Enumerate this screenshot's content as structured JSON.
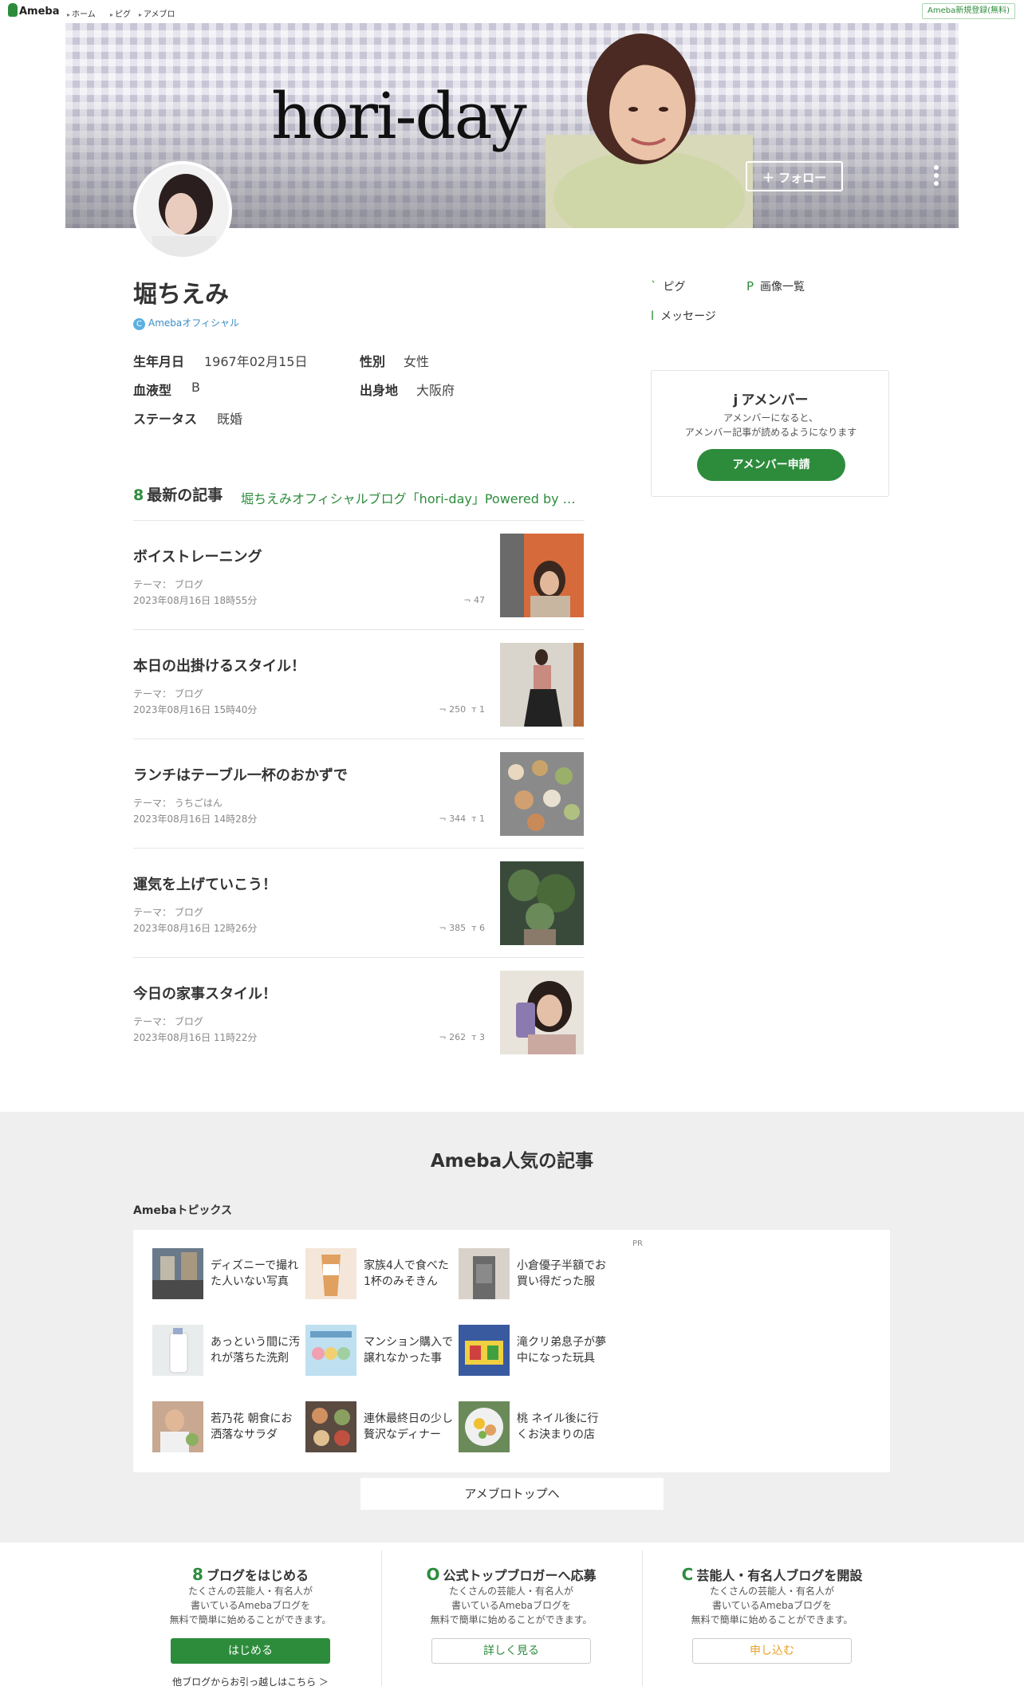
{
  "nav": {
    "logo": "Ameba",
    "crumbs": [
      "ホーム",
      "ピグ",
      "アメブロ"
    ],
    "signup": "Ameba新規登録(無料)"
  },
  "header": {
    "banner_title": "hori-day",
    "follow_label": "＋ フォロー"
  },
  "profile": {
    "name": "堀ちえみ",
    "official_badge": "C",
    "official_label": "Amebaオフィシャル",
    "fields": [
      {
        "label": "生年月日",
        "value": "1967年02月15日"
      },
      {
        "label": "性別",
        "value": "女性"
      },
      {
        "label": "血液型",
        "value": "B"
      },
      {
        "label": "出身地",
        "value": "大阪府"
      },
      {
        "label": "ステータス",
        "value": "既婚"
      }
    ]
  },
  "side_links": [
    {
      "icon": "`",
      "icon_name": "pigg-icon",
      "label": "ピグ"
    },
    {
      "icon": "P",
      "icon_name": "image-list-icon",
      "label": "画像一覧"
    },
    {
      "icon": "l",
      "icon_name": "message-icon",
      "label": "メッセージ"
    }
  ],
  "amember": {
    "icon": "j",
    "title": "アメンバー",
    "desc_line1": "アメンバーになると、",
    "desc_line2": "アメンバー記事が読めるようになります",
    "button": "アメンバー申請"
  },
  "latest": {
    "icon": "8",
    "heading": "最新の記事",
    "blog_name": "堀ちえみオフィシャルブログ「hori-day」Powered by Ameba",
    "articles": [
      {
        "title": "ボイストレーニング",
        "theme": "テーマ： ブログ",
        "date": "2023年08月16日 18時55分",
        "likes": "47",
        "comments": ""
      },
      {
        "title": "本日の出掛けるスタイル！",
        "theme": "テーマ： ブログ",
        "date": "2023年08月16日 15時40分",
        "likes": "250",
        "comments": "1"
      },
      {
        "title": "ランチはテーブル一杯のおかずで",
        "theme": "テーマ： うちごはん",
        "date": "2023年08月16日 14時28分",
        "likes": "344",
        "comments": "1"
      },
      {
        "title": "運気を上げていこう！",
        "theme": "テーマ： ブログ",
        "date": "2023年08月16日 12時26分",
        "likes": "385",
        "comments": "6"
      },
      {
        "title": "今日の家事スタイル！",
        "theme": "テーマ： ブログ",
        "date": "2023年08月16日 11時22分",
        "likes": "262",
        "comments": "3"
      }
    ]
  },
  "popular": {
    "title": "Ameba人気の記事",
    "topics_label": "Amebaトピックス",
    "pr": "PR",
    "topics": [
      {
        "line1": "ディズニーで撮れ",
        "line2": "た人いない写真"
      },
      {
        "line1": "家族4人で食べた",
        "line2": "1杯のみそきん"
      },
      {
        "line1": "小倉優子半額でお",
        "line2": "買い得だった服"
      },
      {
        "line1": "あっという間に汚",
        "line2": "れが落ちた洗剤"
      },
      {
        "line1": "マンション購入で",
        "line2": "譲れなかった事"
      },
      {
        "line1": "滝クリ弟息子が夢",
        "line2": "中になった玩具"
      },
      {
        "line1": "若乃花 朝食にお",
        "line2": "洒落なサラダ"
      },
      {
        "line1": "連休最終日の少し",
        "line2": "贅沢なディナー"
      },
      {
        "line1": "桃 ネイル後に行",
        "line2": "くお決まりの店"
      }
    ],
    "top_button": "アメブロトップへ"
  },
  "footer": {
    "columns": [
      {
        "icon": "8",
        "title": "ブログをはじめる",
        "d1": "たくさんの芸能人・有名人が",
        "d2": "書いているAmebaブログを",
        "d3": "無料で簡単に始めることができます。",
        "button": "はじめる"
      },
      {
        "icon": "O",
        "title": "公式トップブロガーへ応募",
        "d1": "たくさんの芸能人・有名人が",
        "d2": "書いているAmebaブログを",
        "d3": "無料で簡単に始めることができます。",
        "button": "詳しく見る"
      },
      {
        "icon": "C",
        "title": "芸能人・有名人ブログを開設",
        "d1": "たくさんの芸能人・有名人が",
        "d2": "書いているAmebaブログを",
        "d3": "無料で簡単に始めることができます。",
        "button": "申し込む"
      }
    ],
    "migrate": "他ブログからお引っ越しはこちら ＞"
  },
  "colors": {
    "brand_green": "#2d8c3c",
    "link_blue": "#3a8dc6",
    "orange": "#e8a12a"
  }
}
